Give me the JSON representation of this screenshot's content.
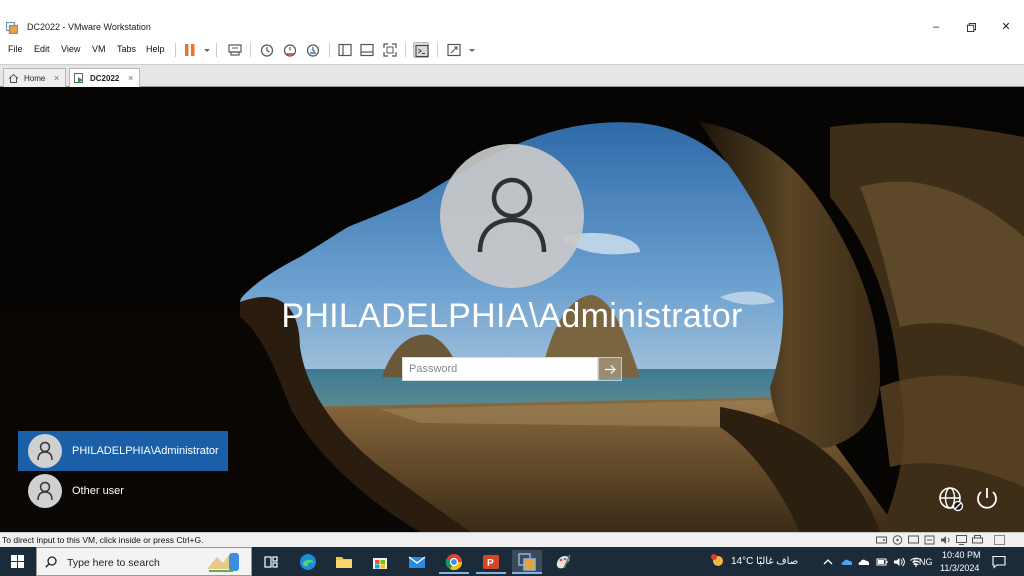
{
  "window": {
    "title": "DC2022 - VMware Workstation"
  },
  "menu": {
    "items": [
      "File",
      "Edit",
      "View",
      "VM",
      "Tabs",
      "Help"
    ]
  },
  "tabs": [
    {
      "label": "Home"
    },
    {
      "label": "DC2022"
    }
  ],
  "lockscreen": {
    "username": "PHILADELPHIA\\Administrator",
    "password_placeholder": "Password",
    "users": [
      "PHILADELPHIA\\Administrator",
      "Other user"
    ]
  },
  "statusbar": {
    "text": "To direct input to this VM, click inside or press Ctrl+G."
  },
  "taskbar": {
    "search_placeholder": "Type here to search",
    "weather": "14°C  صاف غالبًا",
    "language": "ENG",
    "time": "10:40 PM",
    "date": "11/3/2024"
  },
  "colors": {
    "accent": "#1b5fa8",
    "pause_orange": "#e8762b",
    "taskbar": "#1c2b3a"
  }
}
